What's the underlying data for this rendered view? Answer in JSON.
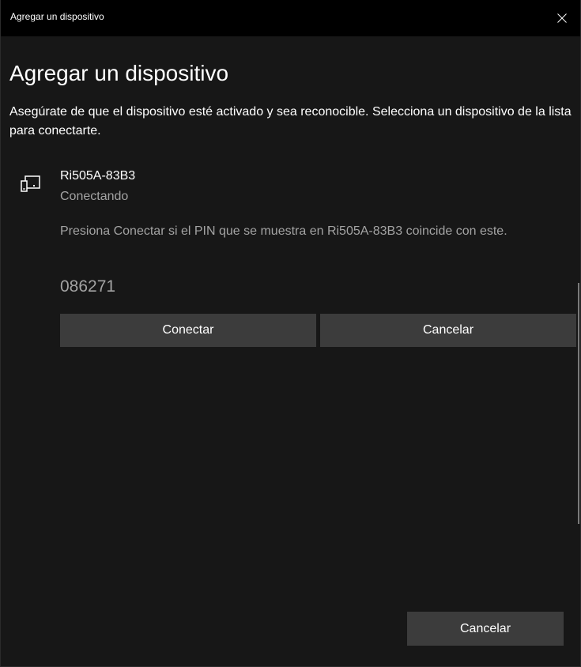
{
  "window": {
    "title": "Agregar un dispositivo"
  },
  "main": {
    "heading": "Agregar un dispositivo",
    "description": "Asegúrate de que el dispositivo esté activado y sea reconocible. Selecciona un dispositivo de la lista para conectarte."
  },
  "device": {
    "icon": "display-device-icon",
    "name": "Ri505A-83B3",
    "status": "Conectando",
    "pin_prompt": "Presiona Conectar si el PIN que se muestra en Ri505A-83B3 coincide con este.",
    "pin": "086271",
    "connect_label": "Conectar",
    "cancel_label": "Cancelar"
  },
  "footer": {
    "cancel_label": "Cancelar"
  },
  "colors": {
    "background": "#171717",
    "titlebar": "#000000",
    "button": "#3c3c3c",
    "secondary_text": "#a3a3a3"
  }
}
